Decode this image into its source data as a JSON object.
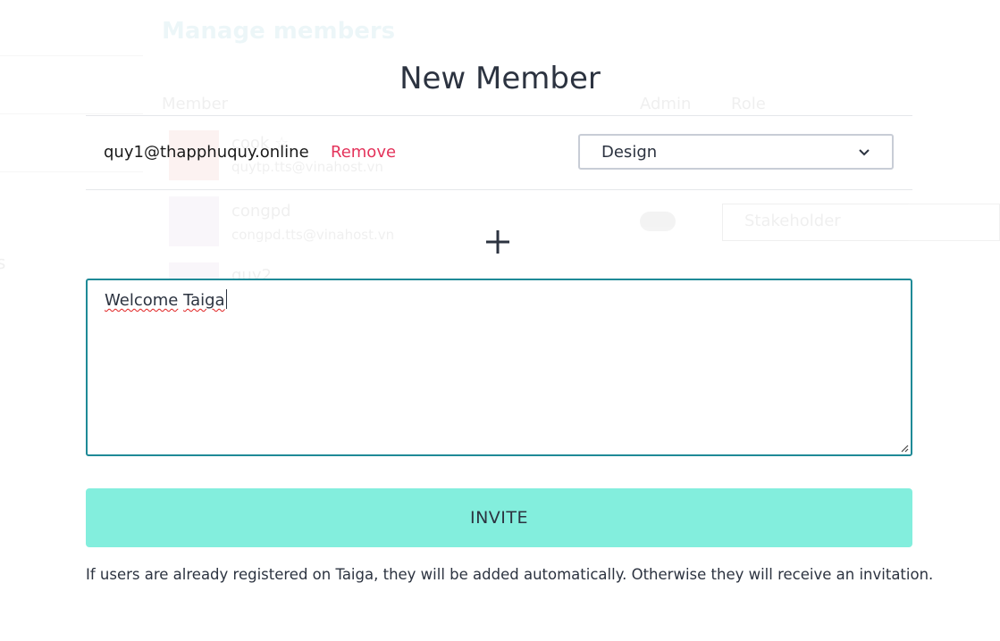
{
  "background": {
    "title": "Manage members",
    "columns": {
      "member": "Member",
      "admin": "Admin",
      "role": "Role"
    },
    "rows": [
      {
        "name": "cook ☆",
        "email": "quytp.tts@vinahost.vn"
      },
      {
        "name": "congpd",
        "email": "congpd.tts@vinahost.vn",
        "role": "Stakeholder"
      },
      {
        "name": "quy2"
      }
    ],
    "side_fragment": "s"
  },
  "dialog": {
    "title": "New Member",
    "member_email": "quy1@thapphuquy.online",
    "remove_label": "Remove",
    "role_value": "Design",
    "add_icon": "plus-icon",
    "message_value": "Welcome Taiga",
    "message_words": [
      "Welcome",
      "Taiga"
    ],
    "invite_label": "INVITE",
    "help_text": "If users are already registered on Taiga, they will be added automatically. Otherwise they will receive an invitation."
  },
  "colors": {
    "remove": "#e4335b",
    "invite_bg": "#83eedd",
    "textarea_border": "#1f8a97",
    "text": "#2c3340"
  }
}
